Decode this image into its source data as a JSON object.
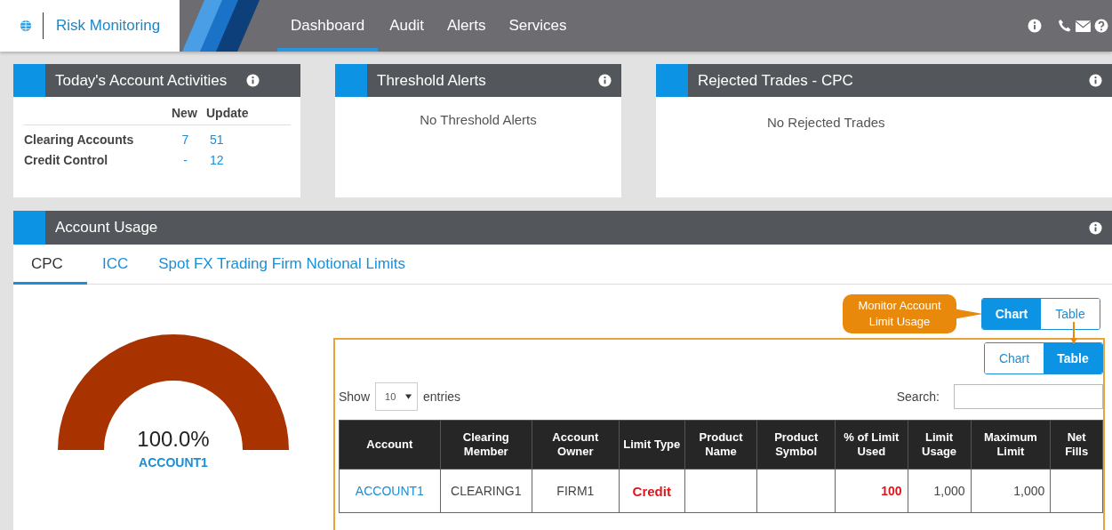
{
  "header": {
    "app_title": "Risk Monitoring",
    "nav": [
      {
        "label": "Dashboard",
        "selected": true
      },
      {
        "label": "Audit",
        "selected": false
      },
      {
        "label": "Alerts",
        "selected": false
      },
      {
        "label": "Services",
        "selected": false
      }
    ]
  },
  "activities": {
    "title": "Today's Account Activities",
    "columns": [
      "New",
      "Update"
    ],
    "rows": [
      {
        "label": "Clearing Accounts",
        "new": "7",
        "update": "51"
      },
      {
        "label": "Credit Control",
        "new": "-",
        "update": "12"
      }
    ]
  },
  "threshold_alerts": {
    "title": "Threshold Alerts",
    "message": "No Threshold Alerts"
  },
  "rejected_trades": {
    "title": "Rejected Trades - CPC",
    "message": "No Rejected Trades"
  },
  "account_usage": {
    "title": "Account Usage",
    "tabs": [
      {
        "label": "CPC",
        "selected": true
      },
      {
        "label": "ICC",
        "selected": false
      },
      {
        "label": "Spot FX Trading Firm Notional Limits",
        "selected": false
      }
    ],
    "gauge": {
      "level": 1.0,
      "reading": "100.0%",
      "account": "ACCOUNT1"
    },
    "callout": "Monitor Account Limit Usage",
    "view_toggle": [
      {
        "label": "Chart",
        "selected": true
      },
      {
        "label": "Table",
        "selected": false
      }
    ],
    "table_view_toggle": [
      {
        "label": "Chart",
        "selected": false
      },
      {
        "label": "Table",
        "selected": true
      }
    ],
    "show_label": "Show",
    "page_size": "10",
    "entries_label": "entries",
    "search_label": "Search:",
    "table": {
      "columns": [
        "Account",
        "Clearing Member",
        "Account Owner",
        "Limit Type",
        "Product Name",
        "Product Symbol",
        "% of Limit Used",
        "Limit Usage",
        "Maximum Limit",
        "Net Fills"
      ],
      "rows": [
        [
          "ACCOUNT1",
          "CLEARING1",
          "FIRM1",
          "Credit",
          "",
          "",
          "100",
          "1,000",
          "1,000",
          ""
        ]
      ]
    }
  }
}
